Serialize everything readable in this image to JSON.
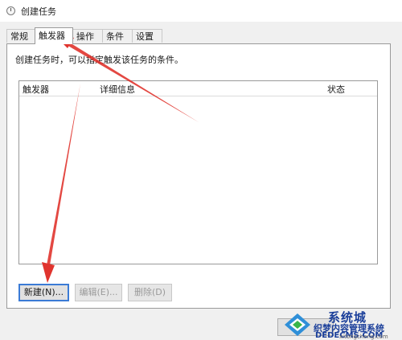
{
  "window": {
    "title": "创建任务"
  },
  "tabs": [
    {
      "label": "常规"
    },
    {
      "label": "触发器"
    },
    {
      "label": "操作"
    },
    {
      "label": "条件"
    },
    {
      "label": "设置"
    }
  ],
  "triggers_panel": {
    "description": "创建任务时，可以指定触发该任务的条件。",
    "columns": {
      "trigger": "触发器",
      "details": "详细信息",
      "status": "状态"
    },
    "rows": []
  },
  "buttons": {
    "new": "新建(N)...",
    "edit": "编辑(E)...",
    "delete": "删除(D)"
  },
  "watermark": {
    "line1": "系统城",
    "line2": "织梦内容管理系统",
    "line3": "DEDECMS.COM",
    "line4": "xitongcheng.com"
  },
  "colors": {
    "arrow": "#e0342e",
    "accent_border": "#3b7bd6",
    "watermark_blue": "#1b3f9a"
  }
}
